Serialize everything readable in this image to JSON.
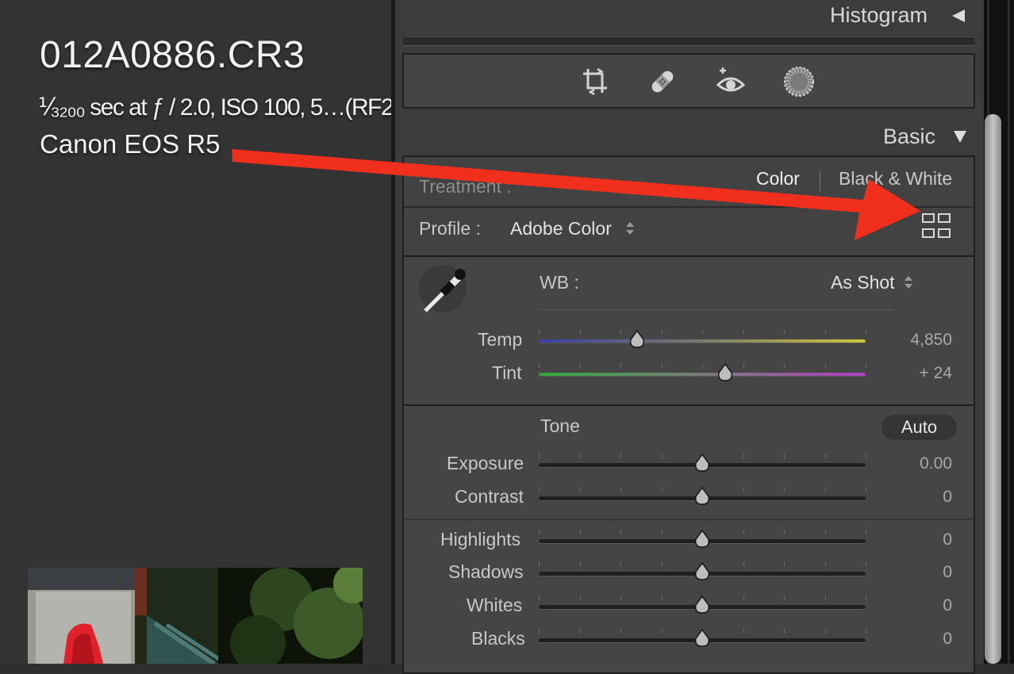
{
  "preview": {
    "filename": "012A0886.CR3",
    "exposure_info": "⅟₃₂₀₀ sec at ƒ / 2.0, ISO 100, 5…(RF2",
    "camera": "Canon EOS R5"
  },
  "panel": {
    "histogram": {
      "title": "Histogram",
      "icon": "triangle-left-icon"
    },
    "tools": [
      "crop-icon",
      "healing-icon",
      "red-eye-icon",
      "mask-icon"
    ],
    "basic": {
      "title": "Basic",
      "icon": "triangle-down-icon",
      "treatment": {
        "label": "Treatment :",
        "color": "Color",
        "bw": "Black & White"
      },
      "profile": {
        "label": "Profile :",
        "value": "Adobe Color",
        "browser_icon": "grid-icon"
      },
      "wb": {
        "label": "WB :",
        "value": "As Shot"
      },
      "temp": {
        "label": "Temp",
        "value": "4,850",
        "position": 0.3
      },
      "tint": {
        "label": "Tint",
        "value": "+ 24",
        "position": 0.57
      },
      "tone": {
        "label": "Tone",
        "auto": "Auto"
      },
      "exposure": {
        "label": "Exposure",
        "value": "0.00",
        "position": 0.5
      },
      "contrast": {
        "label": "Contrast",
        "value": "0",
        "position": 0.5
      },
      "highlights": {
        "label": "Highlights",
        "value": "0",
        "position": 0.5
      },
      "shadows": {
        "label": "Shadows",
        "value": "0",
        "position": 0.5
      },
      "whites": {
        "label": "Whites",
        "value": "0",
        "position": 0.5
      },
      "blacks": {
        "label": "Blacks",
        "value": "0",
        "position": 0.5
      }
    }
  },
  "annotation": {
    "arrow_color": "#f0301c"
  }
}
